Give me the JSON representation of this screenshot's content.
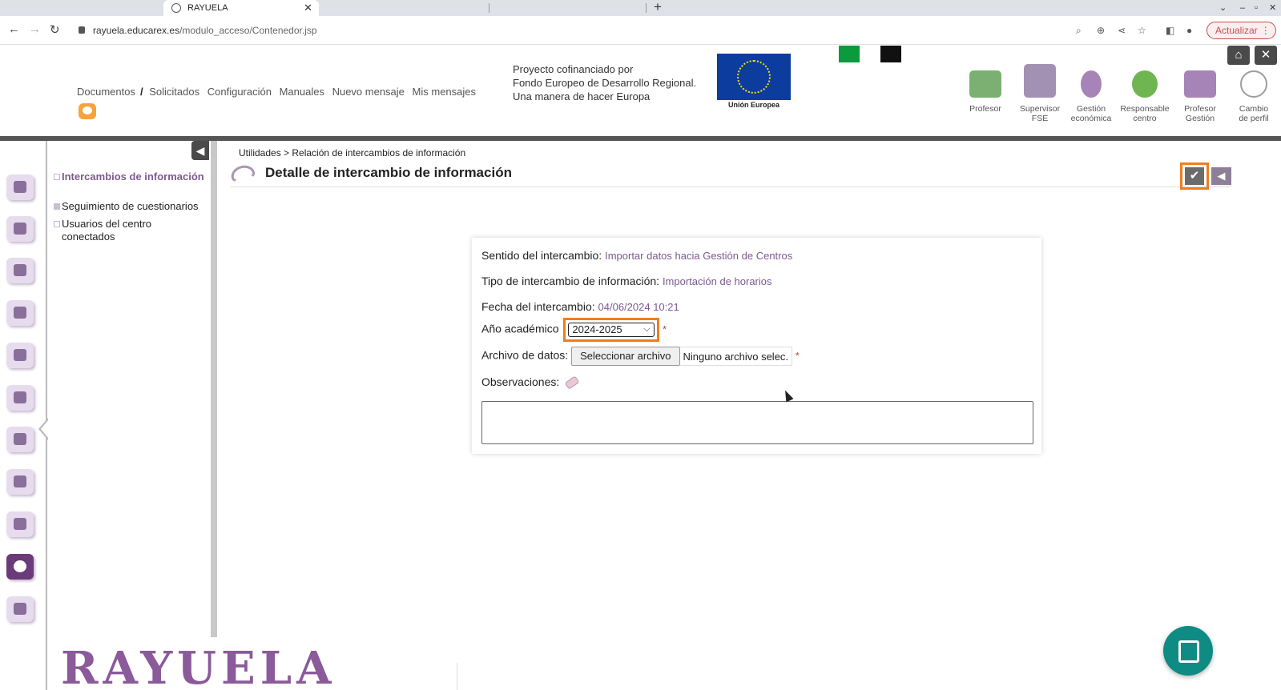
{
  "browser": {
    "tab_title": "RAYUELA",
    "url_host": "rayuela.educarex.es",
    "url_path": "/modulo_acceso/Contenedor.jsp",
    "update_label": "Actualizar"
  },
  "header": {
    "nav": [
      "Documentos",
      "Solicitados",
      "Configuración",
      "Manuales",
      "Nuevo mensaje",
      "Mis mensajes"
    ],
    "cofinanciado": [
      "Proyecto cofinanciado por",
      "Fondo Europeo de Desarrollo Regional.",
      "Una manera de hacer Europa"
    ],
    "eu_label": "Unión Europea",
    "profiles": [
      {
        "line1": "Profesor",
        "line2": "",
        "color": "#7bb072"
      },
      {
        "line1": "Supervisor",
        "line2": "FSE",
        "color": "#a391b3"
      },
      {
        "line1": "Gestión",
        "line2": "económica",
        "color": "#a684b8"
      },
      {
        "line1": "Responsable",
        "line2": "centro",
        "color": "#6fb552"
      },
      {
        "line1": "Profesor",
        "line2": "Gestión",
        "color": "#a684b8"
      },
      {
        "line1": "Cambio",
        "line2": "de perfil",
        "color": "#9d9d9d"
      }
    ]
  },
  "sidemenu": {
    "items": [
      {
        "label": "Intercambios de información"
      },
      {
        "label": "Seguimiento de cuestionarios"
      },
      {
        "label": "Usuarios del centro conectados"
      }
    ],
    "logo": "RAYUELA"
  },
  "main": {
    "breadcrumb": "Utilidades > Relación de intercambios de información",
    "title": "Detalle de intercambio de información",
    "form": {
      "sentido_label": "Sentido del intercambio:",
      "sentido_value": "Importar datos hacia Gestión de Centros",
      "tipo_label": "Tipo de intercambio de información:",
      "tipo_value": "Importación de horarios",
      "fecha_label": "Fecha del intercambio:",
      "fecha_value": "04/06/2024 10:21",
      "anio_label": "Año académico",
      "anio_value": "2024-2025",
      "archivo_label": "Archivo de datos:",
      "archivo_button": "Seleccionar archivo",
      "archivo_value": "Ninguno archivo selec.",
      "observaciones_label": "Observaciones:",
      "required_mark": "*"
    }
  }
}
